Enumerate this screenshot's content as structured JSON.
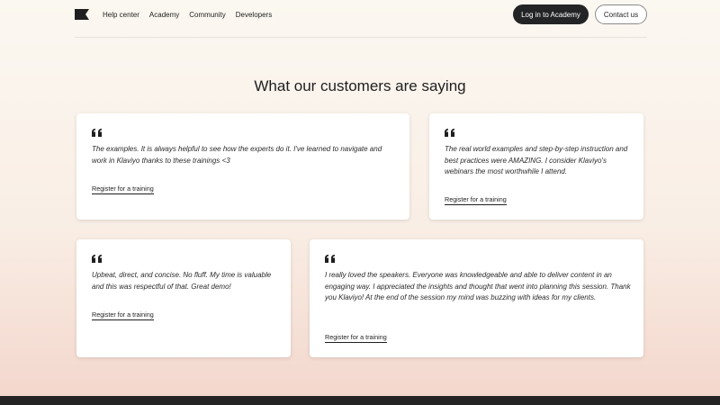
{
  "nav": {
    "logo_icon": "klaviyo-flag-logo",
    "links": [
      "Help center",
      "Academy",
      "Community",
      "Developers"
    ],
    "login_label": "Log in to Academy",
    "contact_label": "Contact us"
  },
  "section": {
    "title": "What our customers are saying"
  },
  "testimonials": [
    {
      "quote": "The examples. It is always helpful to see how the experts do it. I've learned to navigate and work in Klaviyo thanks to these trainings <3",
      "cta": "Register for a training"
    },
    {
      "quote": "The real world examples and step-by-step instruction and best practices were AMAZING. I consider Klaviyo's webinars the most worthwhile I attend.",
      "cta": "Register for a training"
    },
    {
      "quote": "Upbeat, direct, and concise. No fluff. My time is valuable and this was respectful of that. Great demo!",
      "cta": "Register for a training"
    },
    {
      "quote": "I really loved the speakers. Everyone was knowledgeable and able to deliver content in an engaging way. I appreciated the insights and thought that went into planning this session. Thank you Klaviyo! At the end of the session my mind was buzzing with ideas for my clients.",
      "cta": "Register for a training"
    }
  ],
  "colors": {
    "dark_button": "#232426",
    "footer": "#232323",
    "card_background": "#ffffff"
  }
}
